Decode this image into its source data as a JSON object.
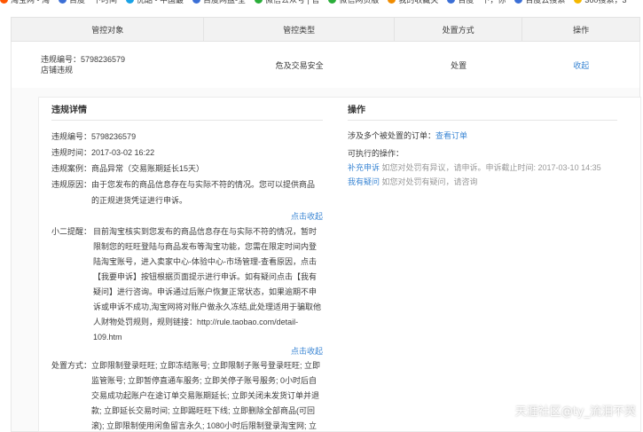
{
  "bookmarks": [
    {
      "label": "淘宝网 - 淘",
      "color": "#ff5500"
    },
    {
      "label": "百度一下时间",
      "color": "#3b6fd6"
    },
    {
      "label": "优酷 - 中国最",
      "color": "#1aa2e6"
    },
    {
      "label": "百度网盘-全",
      "color": "#3b6fd6"
    },
    {
      "label": "微信公众号 | 官",
      "color": "#2aae3a"
    },
    {
      "label": "微信网页版",
      "color": "#2aae3a"
    },
    {
      "label": "我的收藏夹",
      "color": "#f08c00"
    },
    {
      "label": "百度一下，你",
      "color": "#3b6fd6"
    },
    {
      "label": "百度云搜索",
      "color": "#3b6fd6"
    },
    {
      "label": "360搜索，3",
      "color": "#f5b800"
    }
  ],
  "table": {
    "headers": [
      "管控对象",
      "管控类型",
      "处置方式",
      "操作"
    ],
    "row": {
      "violation_no": "违规编号：5798236579",
      "target": "店铺违规",
      "type": "危及交易安全",
      "method": "处置",
      "action": "收起"
    }
  },
  "detail": {
    "title": "违规详情",
    "no_label": "违规编号：",
    "no_value": "5798236579",
    "time_label": "违规时间：",
    "time_value": "2017-03-02 16:22",
    "case_label": "违规案例：",
    "case_value": "商品异常（交易账期延长15天）",
    "reason_label": "违规原因：",
    "reason_value": "由于您发布的商品信息存在与实际不符的情况。您可以提供商品的正规进货凭证进行申诉。",
    "toggle1": "点击收起",
    "tip_label": "小二提醒：",
    "tip_value": "目前淘宝核实到您发布的商品信息存在与实际不符的情况，暂时限制您的旺旺登陆与商品发布等淘宝功能，您需在限定时间内登陆淘宝账号，进入卖家中心-体验中心-市场管理-查看原因，点击【我要申诉】按钮根据页面提示进行申诉。如有疑问点击【我有疑问】进行咨询。申诉通过后账户恢复正常状态，如果逾期不申诉或申诉不成功,淘宝网将对账户做永久冻结,此处理适用于骗取他人财物处罚规则，规则链接：http://rule.taobao.com/detail-109.htm",
    "toggle2": "点击收起",
    "method_label": "处置方式：",
    "method_value": "立即限制登录旺旺; 立即冻结账号; 立即限制子账号登录旺旺; 立即监管账号; 立即暂停直通车服务; 立即关停子账号服务; 0小时后自交易成功起账户在途订单交易账期延长; 立即关闭未发货订单并退款; 立即延长交易时间; 立即踢旺旺下线; 立即删除全部商品(可回滚); 立即限制使用闲鱼留言永久; 1080小时后限制登录淘宝网; 立即限制发布商品; 立即限制使用闲鱼私信永久"
  },
  "operations": {
    "title": "操作",
    "multi_prefix": "涉及多个被处置的订单：",
    "view_orders": "查看订单",
    "available_ops": "可执行的操作：",
    "appeal_link": "补充申诉",
    "appeal_desc": "如您对处罚有异议，请申诉。申诉截止时间: 2017-03-10 14:35",
    "question_link": "我有疑问",
    "question_desc": "如您对处罚有疑问，请咨询"
  },
  "watermark": "天涯社区@ty_流泪不哭"
}
